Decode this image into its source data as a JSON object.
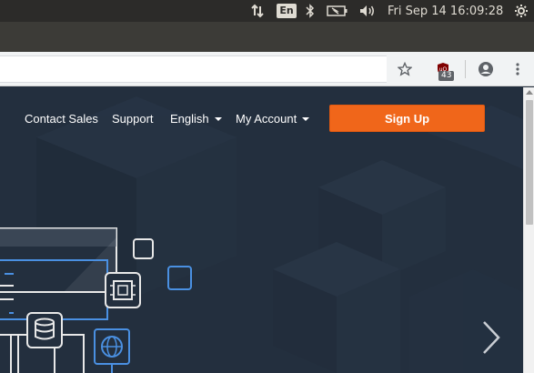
{
  "system_panel": {
    "language": "En",
    "datetime": "Fri Sep 14 16:09:28"
  },
  "browser": {
    "extension_badge": "43",
    "icons": [
      "star-icon",
      "ublock-icon",
      "profile-icon",
      "kebab-menu-icon"
    ]
  },
  "nav": {
    "contact_sales": "Contact Sales",
    "support": "Support",
    "language": "English",
    "my_account": "My Account",
    "sign_up": "Sign Up"
  },
  "colors": {
    "page_bg": "#232f3e",
    "signup_orange": "#f0661a",
    "accent_blue": "#4a90e2"
  }
}
